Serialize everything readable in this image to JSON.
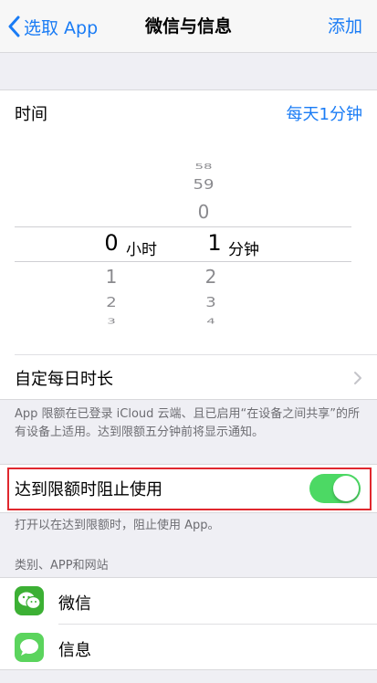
{
  "navbar": {
    "back_label": "选取 App",
    "title": "微信与信息",
    "add_label": "添加"
  },
  "time": {
    "label": "时间",
    "value": "每天1分钟"
  },
  "picker": {
    "hours": {
      "above": [
        "",
        "",
        ""
      ],
      "selected": "0",
      "unit": "小时",
      "below": [
        "1",
        "2",
        "3"
      ]
    },
    "minutes": {
      "above": [
        "58",
        "59",
        "0"
      ],
      "selected": "1",
      "unit": "分钟",
      "below": [
        "2",
        "3",
        "4"
      ]
    }
  },
  "custom_daily": {
    "label": "自定每日时长"
  },
  "footnote1": "App 限额在已登录 iCloud 云端、且已启用“在设备之间共享”的所有设备上适用。达到限额五分钟前将显示通知。",
  "block": {
    "label": "达到限额时阻止使用",
    "enabled": true
  },
  "footnote2": "打开以在达到限额时，阻止使用 App。",
  "apps_section": {
    "header": "类别、APP和网站",
    "items": [
      {
        "label": "微信",
        "icon": "wechat-icon",
        "color": "#3cb034"
      },
      {
        "label": "信息",
        "icon": "messages-icon",
        "color": "#5bd45d"
      }
    ]
  },
  "colors": {
    "accent": "#1a7cf5",
    "toggle_on": "#4cd964",
    "highlight": "#e0282e"
  }
}
